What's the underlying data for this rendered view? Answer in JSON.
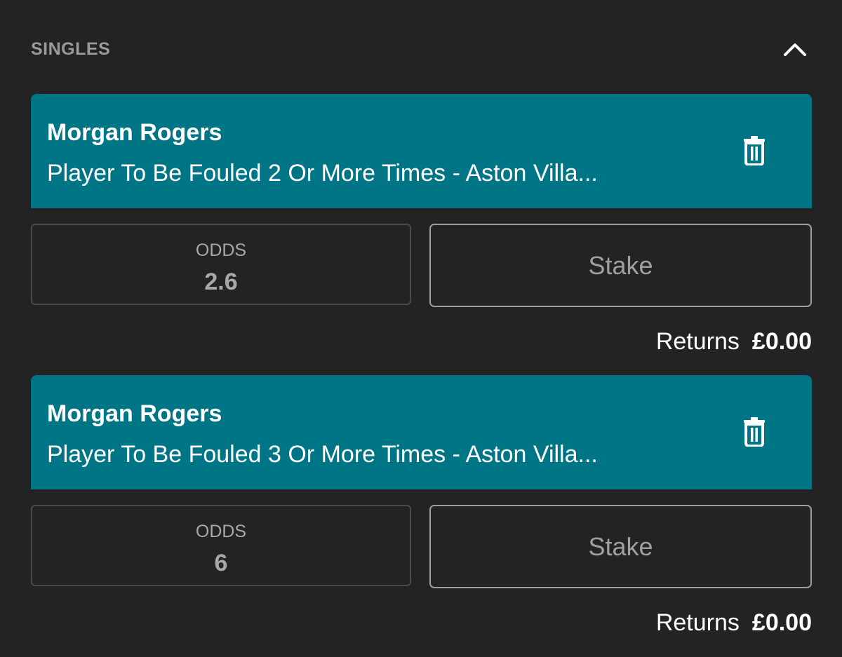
{
  "section": {
    "title": "SINGLES",
    "collapse_icon": "chevron-up-icon"
  },
  "bets": [
    {
      "selection": "Morgan Rogers",
      "market": "Player To Be Fouled 2 Or More Times - Aston Villa...",
      "odds_label": "ODDS",
      "odds": "2.6",
      "stake_placeholder": "Stake",
      "returns_label": "Returns",
      "returns_value": "£0.00",
      "delete_icon": "trash-icon"
    },
    {
      "selection": "Morgan Rogers",
      "market": "Player To Be Fouled 3 Or More Times - Aston Villa...",
      "odds_label": "ODDS",
      "odds": "6",
      "stake_placeholder": "Stake",
      "returns_label": "Returns",
      "returns_value": "£0.00",
      "delete_icon": "trash-icon"
    }
  ],
  "colors": {
    "background": "#232325",
    "bet_header": "#007585",
    "muted_text": "#9a9a9c"
  }
}
